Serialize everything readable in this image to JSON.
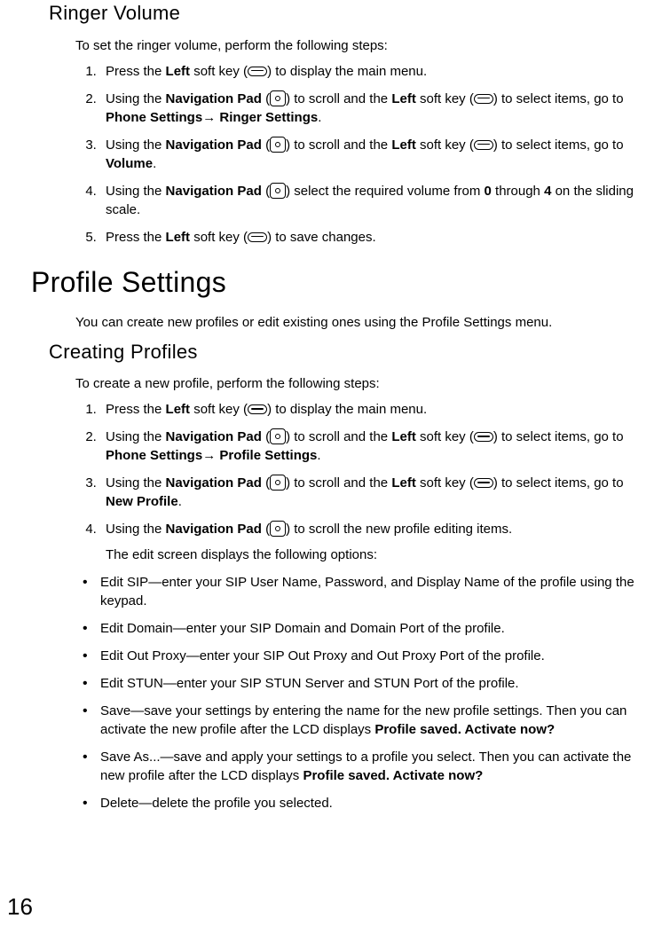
{
  "pageNumber": "16",
  "ringer": {
    "heading": "Ringer Volume",
    "intro": "To set the ringer volume, perform the following steps:",
    "step1_a": "Press the ",
    "step1_b": "Left",
    "step1_c": " soft key (",
    "step1_d": ") to display the main menu.",
    "step2_a": "Using the ",
    "step2_b": "Navigation Pad",
    "step2_c": " (",
    "step2_d": ") to scroll and the ",
    "step2_e": "Left",
    "step2_f": " soft key (",
    "step2_g": ") to select items, go to ",
    "step2_h": "Phone Settings",
    "step2_arrow": "→ ",
    "step2_i": "Ringer Settings",
    "step2_j": ".",
    "step3_a": "Using the ",
    "step3_b": "Navigation Pad",
    "step3_c": " (",
    "step3_d": ") to scroll and the ",
    "step3_e": "Left",
    "step3_f": " soft key (",
    "step3_g": ") to select items, go to ",
    "step3_h": "Volume",
    "step3_i": ".",
    "step4_a": "Using the ",
    "step4_b": "Navigation Pad",
    "step4_c": " (",
    "step4_d": ") select the required volume from ",
    "step4_e": "0",
    "step4_f": " through ",
    "step4_g": "4",
    "step4_h": " on the sliding scale.",
    "step5_a": "Press the ",
    "step5_b": "Left",
    "step5_c": " soft key (",
    "step5_d": ") to save changes."
  },
  "profile": {
    "heading": "Profile Settings",
    "intro": "You can create new profiles or edit existing ones using the Profile Settings menu.",
    "creating_heading": "Creating Profiles",
    "creating_intro": "To create a new profile, perform the following steps:",
    "step1_a": "Press the ",
    "step1_b": "Left",
    "step1_c": " soft key (",
    "step1_d": ") to display the main menu.",
    "step2_a": "Using the ",
    "step2_b": "Navigation Pad",
    "step2_c": " (",
    "step2_d": ") to scroll and the ",
    "step2_e": "Left",
    "step2_f": " soft key (",
    "step2_g": ") to select items, go to ",
    "step2_h": "Phone Settings",
    "step2_arrow": "→ ",
    "step2_i": "Profile Settings",
    "step2_j": ".",
    "step3_a": "Using the ",
    "step3_b": "Navigation Pad",
    "step3_c": " (",
    "step3_d": ") to scroll and the ",
    "step3_e": "Left",
    "step3_f": " soft key (",
    "step3_g": ") to select items, go to ",
    "step3_h": "New Profile",
    "step3_i": ".",
    "step4_a": "Using the ",
    "step4_b": "Navigation Pad",
    "step4_c": " (",
    "step4_d": ") to scroll the new profile editing items.",
    "edit_intro": "The edit screen displays the following options:",
    "bullets": {
      "sip": "Edit SIP—enter your SIP User Name, Password, and Display Name of the pro­file using the keypad.",
      "domain": "Edit Domain—enter your SIP Domain and Domain Port of the profile.",
      "outproxy": "Edit Out Proxy—enter your SIP Out Proxy and Out Proxy Port of the profile.",
      "stun": "Edit STUN—enter your SIP STUN Server and STUN Port of the profile.",
      "save_a": "Save—save your settings by entering the name for the new profile settings. Then you can activate the new profile after the LCD displays ",
      "save_b": "Profile saved. Activate now?",
      "saveas_a": "Save As...—save and apply your settings to a profile you select. Then you can activate the new profile after the LCD displays ",
      "saveas_b": "Profile saved. Activate now?",
      "delete": "Delete—delete the profile you selected."
    }
  }
}
